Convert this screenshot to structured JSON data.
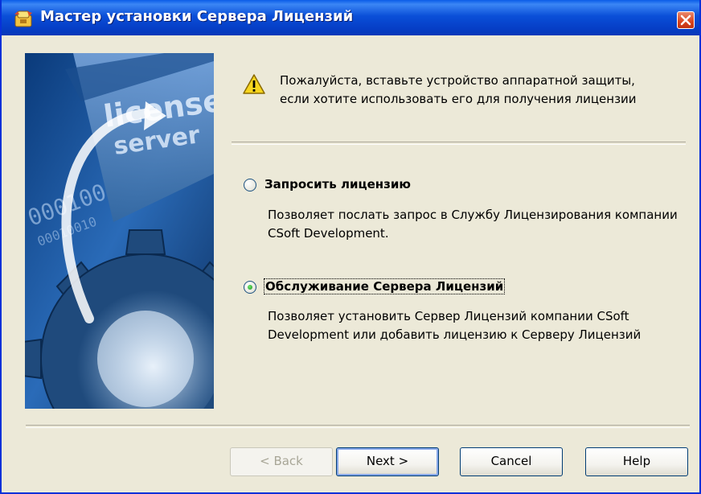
{
  "window": {
    "title": "Мастер установки Сервера Лицензий",
    "app_icon": "installer-icon",
    "close_icon": "close-icon"
  },
  "banner": {
    "text_line1": "license",
    "text_line2": "server",
    "binary_text": "000100",
    "binary_text2": "00010010"
  },
  "notice": {
    "icon": "warning-icon",
    "text": "Пожалуйста, вставьте устройство аппаратной защиты, если хотите использовать его для получения лицензии"
  },
  "options": [
    {
      "label": "Запросить лицензию",
      "description": "Позволяет послать запрос в Службу Лицензирования компании CSoft Development.",
      "selected": false
    },
    {
      "label": "Обслуживание Сервера Лицензий",
      "description": "Позволяет установить Сервер Лицензий компании CSoft Development или добавить лицензию к Серверу Лицензий",
      "selected": true
    }
  ],
  "buttons": {
    "back": "< Back",
    "next": "Next >",
    "cancel": "Cancel",
    "help": "Help"
  },
  "colors": {
    "titlebar": "#0a4fd8",
    "dialog_bg": "#ece9d8",
    "radio_selected": "#1d9a1d"
  }
}
